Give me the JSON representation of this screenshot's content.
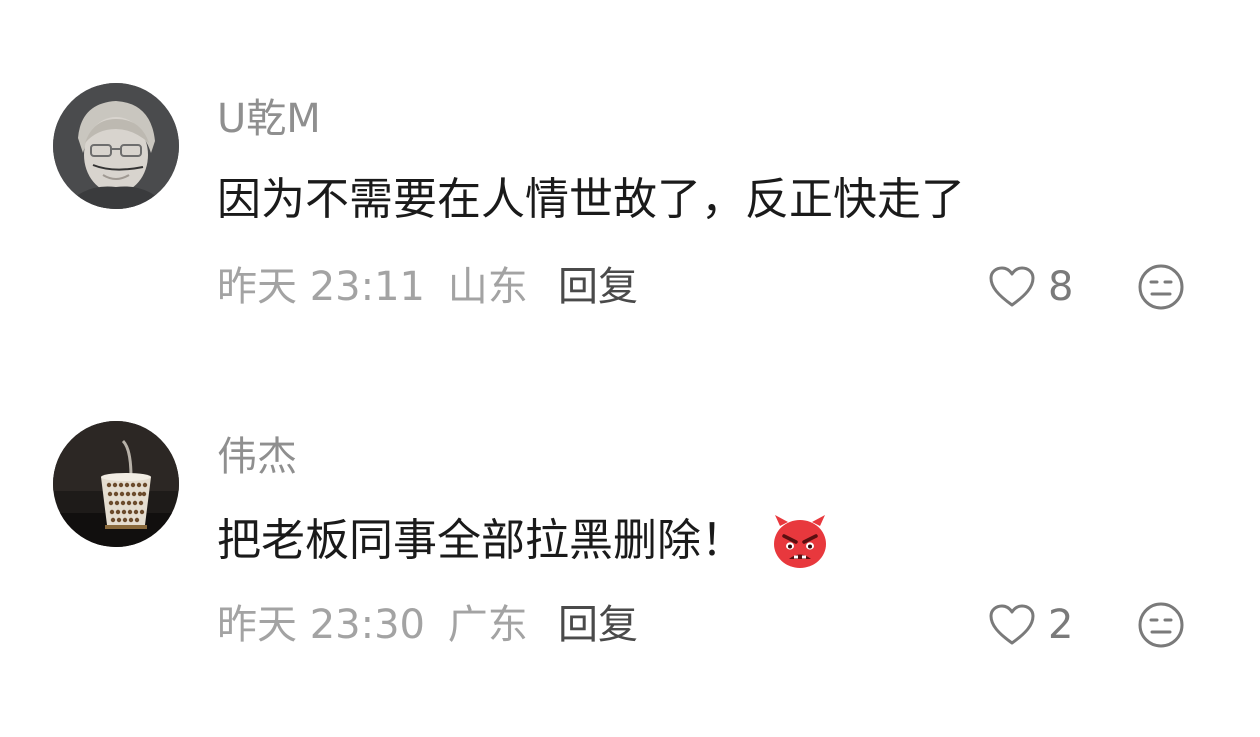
{
  "comments": [
    {
      "username": "U乾M",
      "text": "因为不需要在人情世故了，反正快走了",
      "time": "昨天 23:11",
      "location": "山东",
      "reply_label": "回复",
      "likes": "8",
      "avatar_icon": "avatar-person-glasses",
      "emoji_icon": ""
    },
    {
      "username": "伟杰",
      "text": "把老板同事全部拉黑删除！",
      "time": "昨天 23:30",
      "location": "广东",
      "reply_label": "回复",
      "likes": "2",
      "avatar_icon": "avatar-cup-photo",
      "emoji_icon": "angry-devil-emoji"
    }
  ],
  "colors": {
    "username": "#8f8f8f",
    "text": "#1a1a1a",
    "meta": "#a3a3a3",
    "reply": "#4a4a4a",
    "icon": "#7a7a7a",
    "emoji": "#e8383d"
  }
}
